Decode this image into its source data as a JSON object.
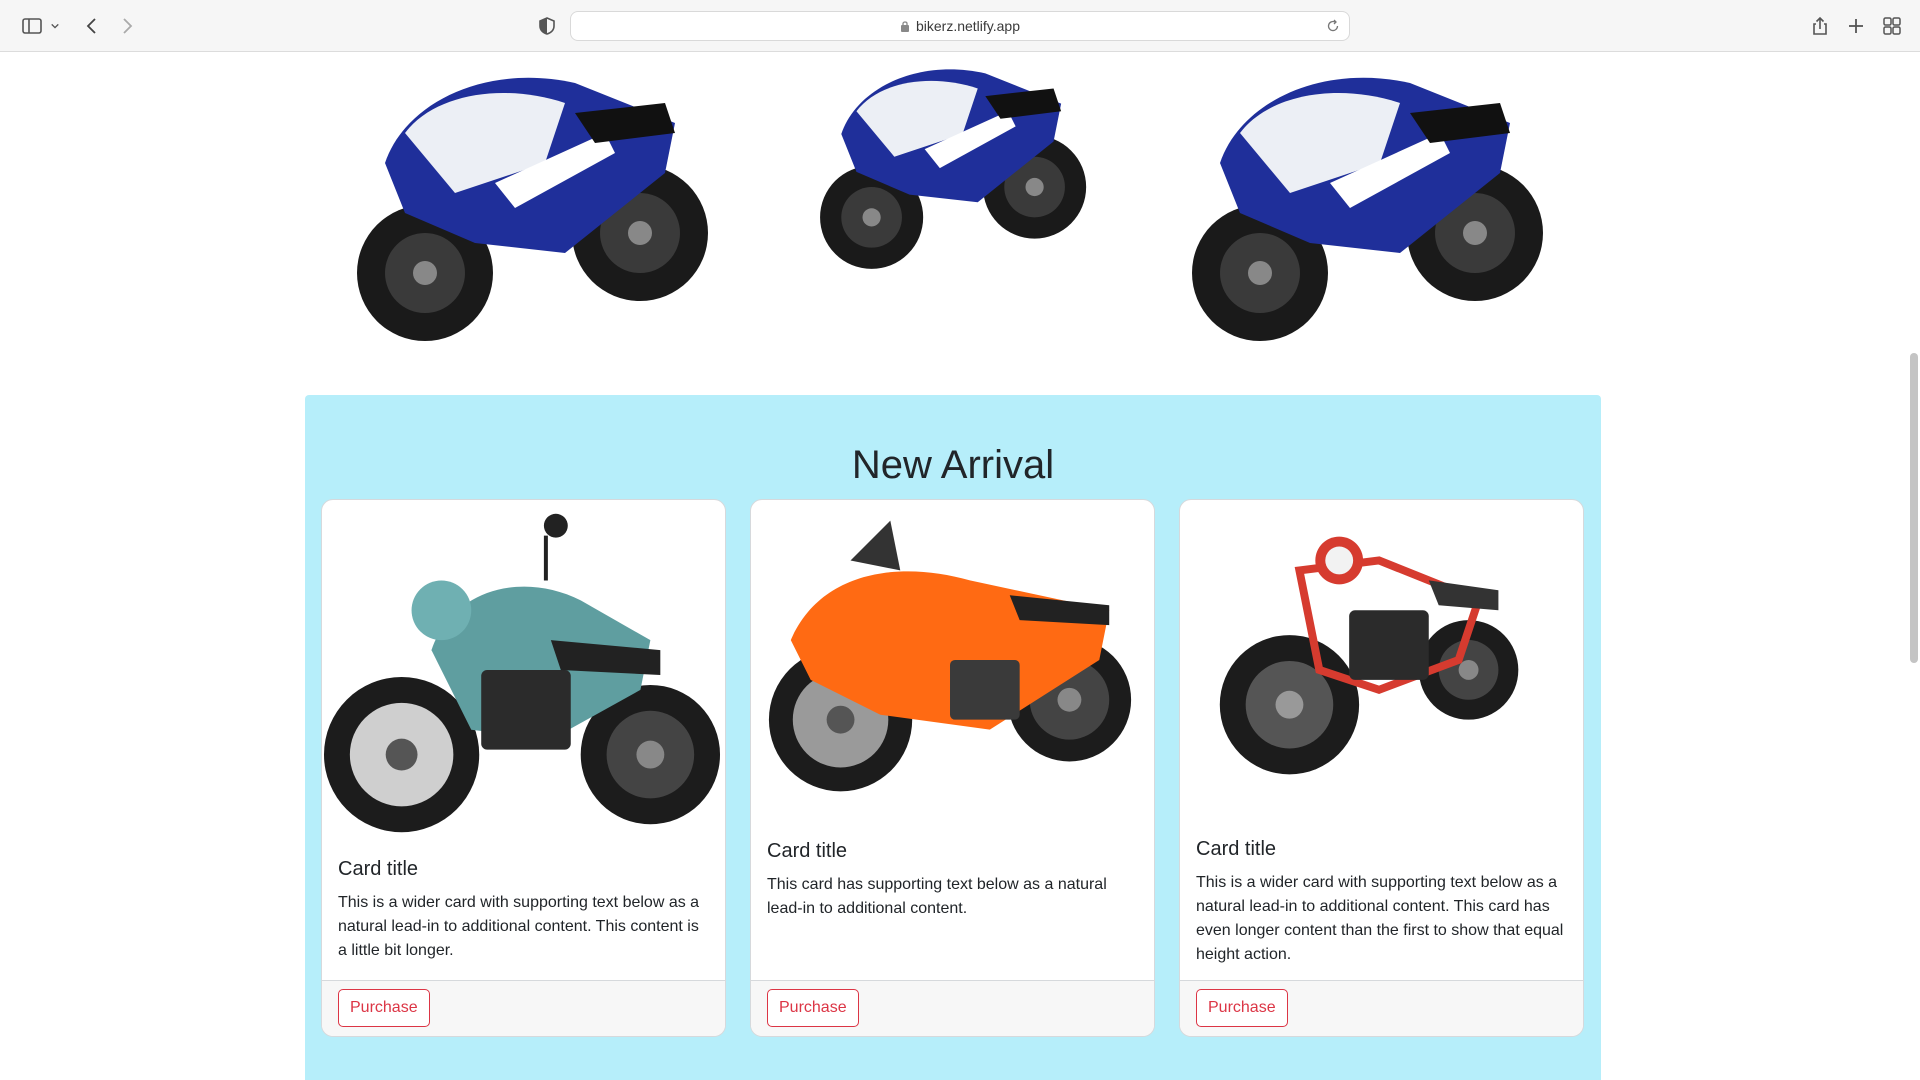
{
  "browser": {
    "url": "bikerz.netlify.app"
  },
  "arrival": {
    "title": "New Arrival",
    "cards": [
      {
        "title": "Card title",
        "text": "This is a wider card with supporting text below as a natural lead-in to additional content. This content is a little bit longer.",
        "button": "Purchase",
        "bike_color": "#5f9ea0"
      },
      {
        "title": "Card title",
        "text": "This card has supporting text below as a natural lead-in to additional content.",
        "button": "Purchase",
        "bike_color": "#ff6a13"
      },
      {
        "title": "Card title",
        "text": "This is a wider card with supporting text below as a natural lead-in to additional content. This card has even longer content than the first to show that equal height action.",
        "button": "Purchase",
        "bike_color": "#d63b2f"
      }
    ]
  },
  "colors": {
    "arrival_bg": "#b6eefa",
    "button_accent": "#dc3545",
    "hero_bike_blue": "#1f2f9a"
  }
}
